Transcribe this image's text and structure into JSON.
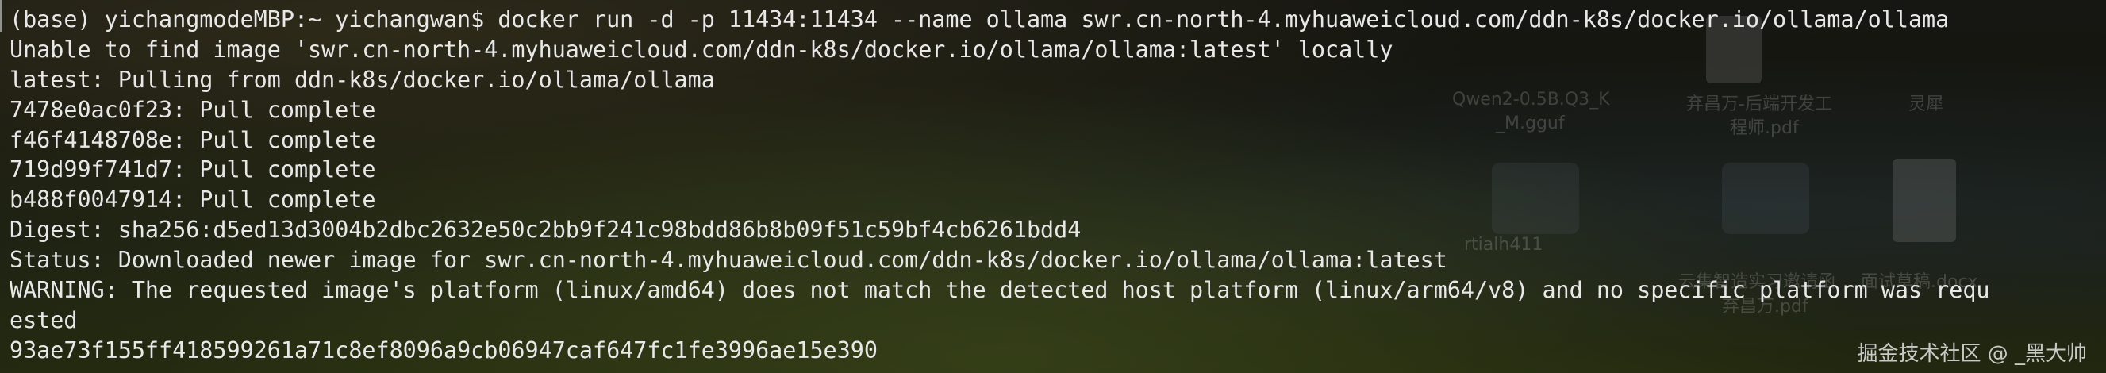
{
  "terminal": {
    "lines": [
      "(base) yichangmodeMBP:~ yichangwan$ docker run -d -p 11434:11434 --name ollama swr.cn-north-4.myhuaweicloud.com/ddn-k8s/docker.io/ollama/ollama",
      "Unable to find image 'swr.cn-north-4.myhuaweicloud.com/ddn-k8s/docker.io/ollama/ollama:latest' locally",
      "latest: Pulling from ddn-k8s/docker.io/ollama/ollama",
      "7478e0ac0f23: Pull complete",
      "f46f4148708e: Pull complete",
      "719d99f741d7: Pull complete",
      "b488f0047914: Pull complete",
      "Digest: sha256:d5ed13d3004b2dbc2632e50c2bb9f241c98bdd86b8b09f51c59bf4cb6261bdd4",
      "Status: Downloaded newer image for swr.cn-north-4.myhuaweicloud.com/ddn-k8s/docker.io/ollama/ollama:latest",
      "WARNING: The requested image's platform (linux/amd64) does not match the detected host platform (linux/arm64/v8) and no specific platform was requ",
      "ested",
      "93ae73f155ff418599261a71c8ef8096a9cb06947caf647fc1fe3996ae15e390"
    ]
  },
  "desktop": {
    "icons": [
      {
        "label": "Qwen2-0.5B.Q3_K",
        "label2": "_M.gguf"
      },
      {
        "label": "弃昌万-后端开发工",
        "label2": "程师.pdf"
      },
      {
        "label": "灵犀",
        "label2": ""
      },
      {
        "label": "rtialh411",
        "label2": ""
      },
      {
        "label": "云集智造实习邀请函",
        "label2": "弃昌万.pdf"
      },
      {
        "label": "面试草稿.docx",
        "label2": ""
      }
    ]
  },
  "watermark": "掘金技术社区 @ _黑大帅",
  "colors": {
    "text": "#e8e8e8",
    "background": "#15170f"
  }
}
